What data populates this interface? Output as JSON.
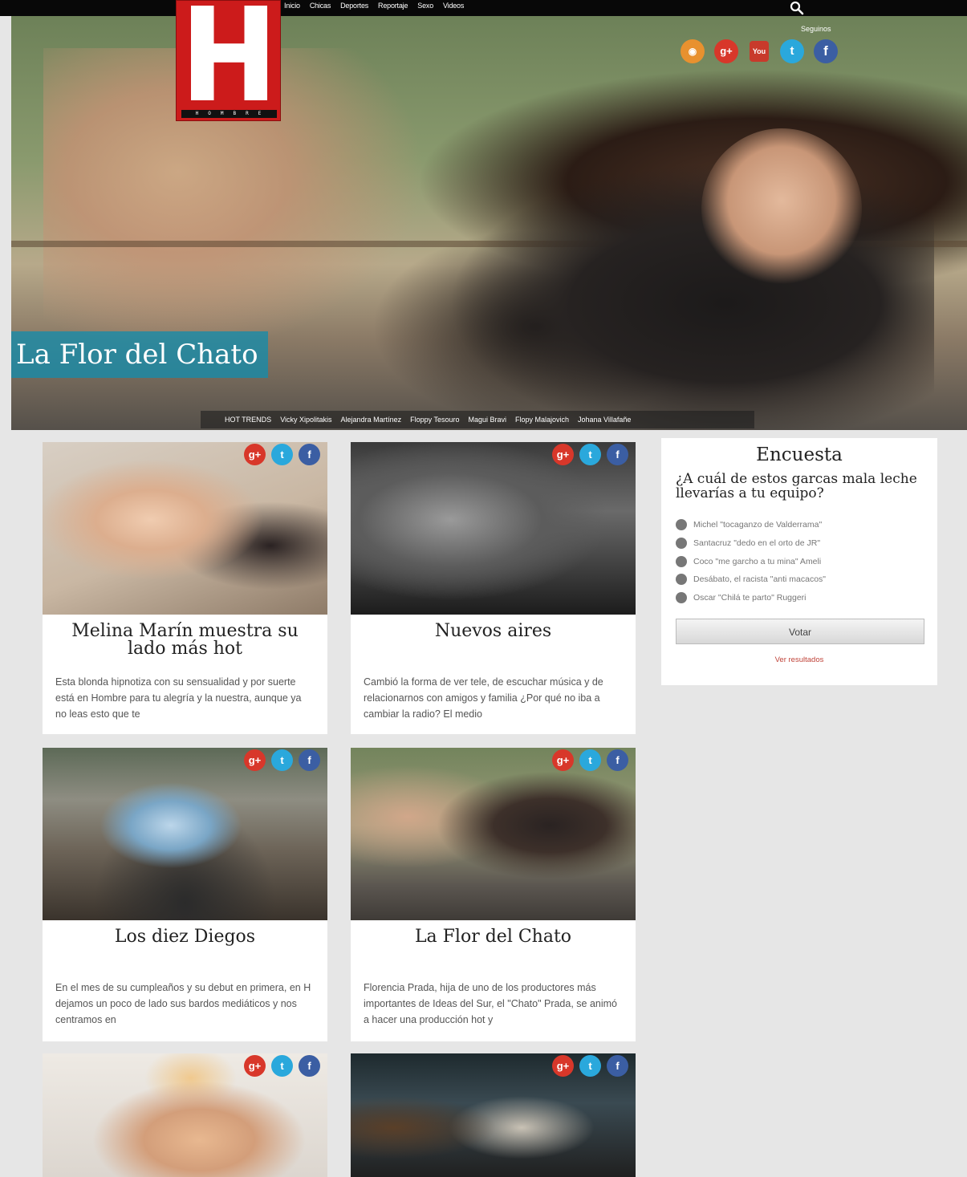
{
  "nav": {
    "items": [
      "Inicio",
      "Chicas",
      "Deportes",
      "Reportaje",
      "Sexo",
      "Videos"
    ]
  },
  "logo": {
    "strip": "HOMBRE"
  },
  "social_top": {
    "label": "Seguinos"
  },
  "hero": {
    "title": "La Flor del Chato"
  },
  "trends": {
    "label": "HOT TRENDS",
    "items": [
      "Vicky Xipolitakis",
      "Alejandra Martínez",
      "Floppy Tesouro",
      "Magui Bravi",
      "Flopy Malajovich",
      "Johana Villafañe"
    ]
  },
  "cards": [
    {
      "title": "Melina Marín muestra su lado más hot",
      "excerpt": "Esta blonda hipnotiza con su sensualidad y por suerte está en Hombre para tu alegría y la nuestra, aunque ya no leas esto que te"
    },
    {
      "title": "Nuevos aires",
      "excerpt": "Cambió la forma de ver tele, de escuchar música y de relacionarnos con amigos y familia ¿Por qué no iba a cambiar la radio? El medio"
    },
    {
      "title": "Los diez Diegos",
      "excerpt": " En el mes de su cumpleaños y su debut en primera, en H dejamos un poco de lado sus bardos mediáticos y nos centramos en"
    },
    {
      "title": "La Flor del Chato",
      "excerpt": "Florencia Prada, hija de uno de los productores más importantes de Ideas del Sur, el \"Chato\" Prada, se animó a hacer una producción hot y"
    },
    {
      "title": "",
      "excerpt": ""
    },
    {
      "title": "",
      "excerpt": ""
    }
  ],
  "poll": {
    "heading": "Encuesta",
    "question": "¿A cuál de estos garcas mala leche llevarías a tu equipo?",
    "options": [
      "Michel \"tocaganzo de Valderrama\"",
      "Santacruz \"dedo en el orto de JR\"",
      "Coco \"me garcho a tu mina\" Ameli",
      "Desábato, el racista \"anti macacos\"",
      "Oscar \"Chilá te parto\" Ruggeri"
    ],
    "vote": "Votar",
    "results": "Ver resultados"
  },
  "icons": {
    "share": [
      "google-plus-icon",
      "twitter-icon",
      "facebook-icon"
    ],
    "top": [
      "rss-icon",
      "google-plus-icon",
      "youtube-icon",
      "twitter-icon",
      "facebook-icon"
    ]
  }
}
